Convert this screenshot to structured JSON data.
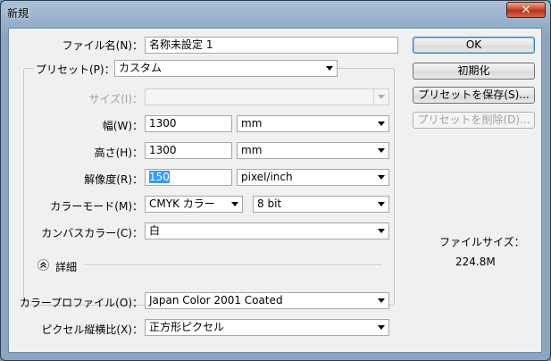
{
  "window": {
    "title": "新規",
    "close_glyph": "✕"
  },
  "form": {
    "name": {
      "label": "ファイル名(N)：",
      "value": "名称未設定 1"
    },
    "preset": {
      "label": "プリセット(P)：",
      "value": "カスタム"
    },
    "size": {
      "label": "サイズ(I)：",
      "value": ""
    },
    "width": {
      "label": "幅(W)：",
      "value": "1300",
      "unit": "mm"
    },
    "height": {
      "label": "高さ(H)：",
      "value": "1300",
      "unit": "mm"
    },
    "resolution": {
      "label": "解像度(R)：",
      "value": "150",
      "unit": "pixel/inch"
    },
    "color_mode": {
      "label": "カラーモード(M)：",
      "value": "CMYK カラー",
      "depth": "8 bit"
    },
    "background": {
      "label": "カンバスカラー(C)：",
      "value": "白"
    },
    "advanced": {
      "label": "詳細"
    },
    "color_profile": {
      "label": "カラープロファイル(O)：",
      "value": "Japan Color 2001 Coated"
    },
    "pixel_aspect": {
      "label": "ピクセル縦横比(X)：",
      "value": "正方形ピクセル"
    }
  },
  "buttons": {
    "ok": "OK",
    "reset": "初期化",
    "save_preset": "プリセットを保存(S)...",
    "delete_preset": "プリセットを削除(D)..."
  },
  "file_size": {
    "label": "ファイルサイズ：",
    "value": "224.8M"
  }
}
